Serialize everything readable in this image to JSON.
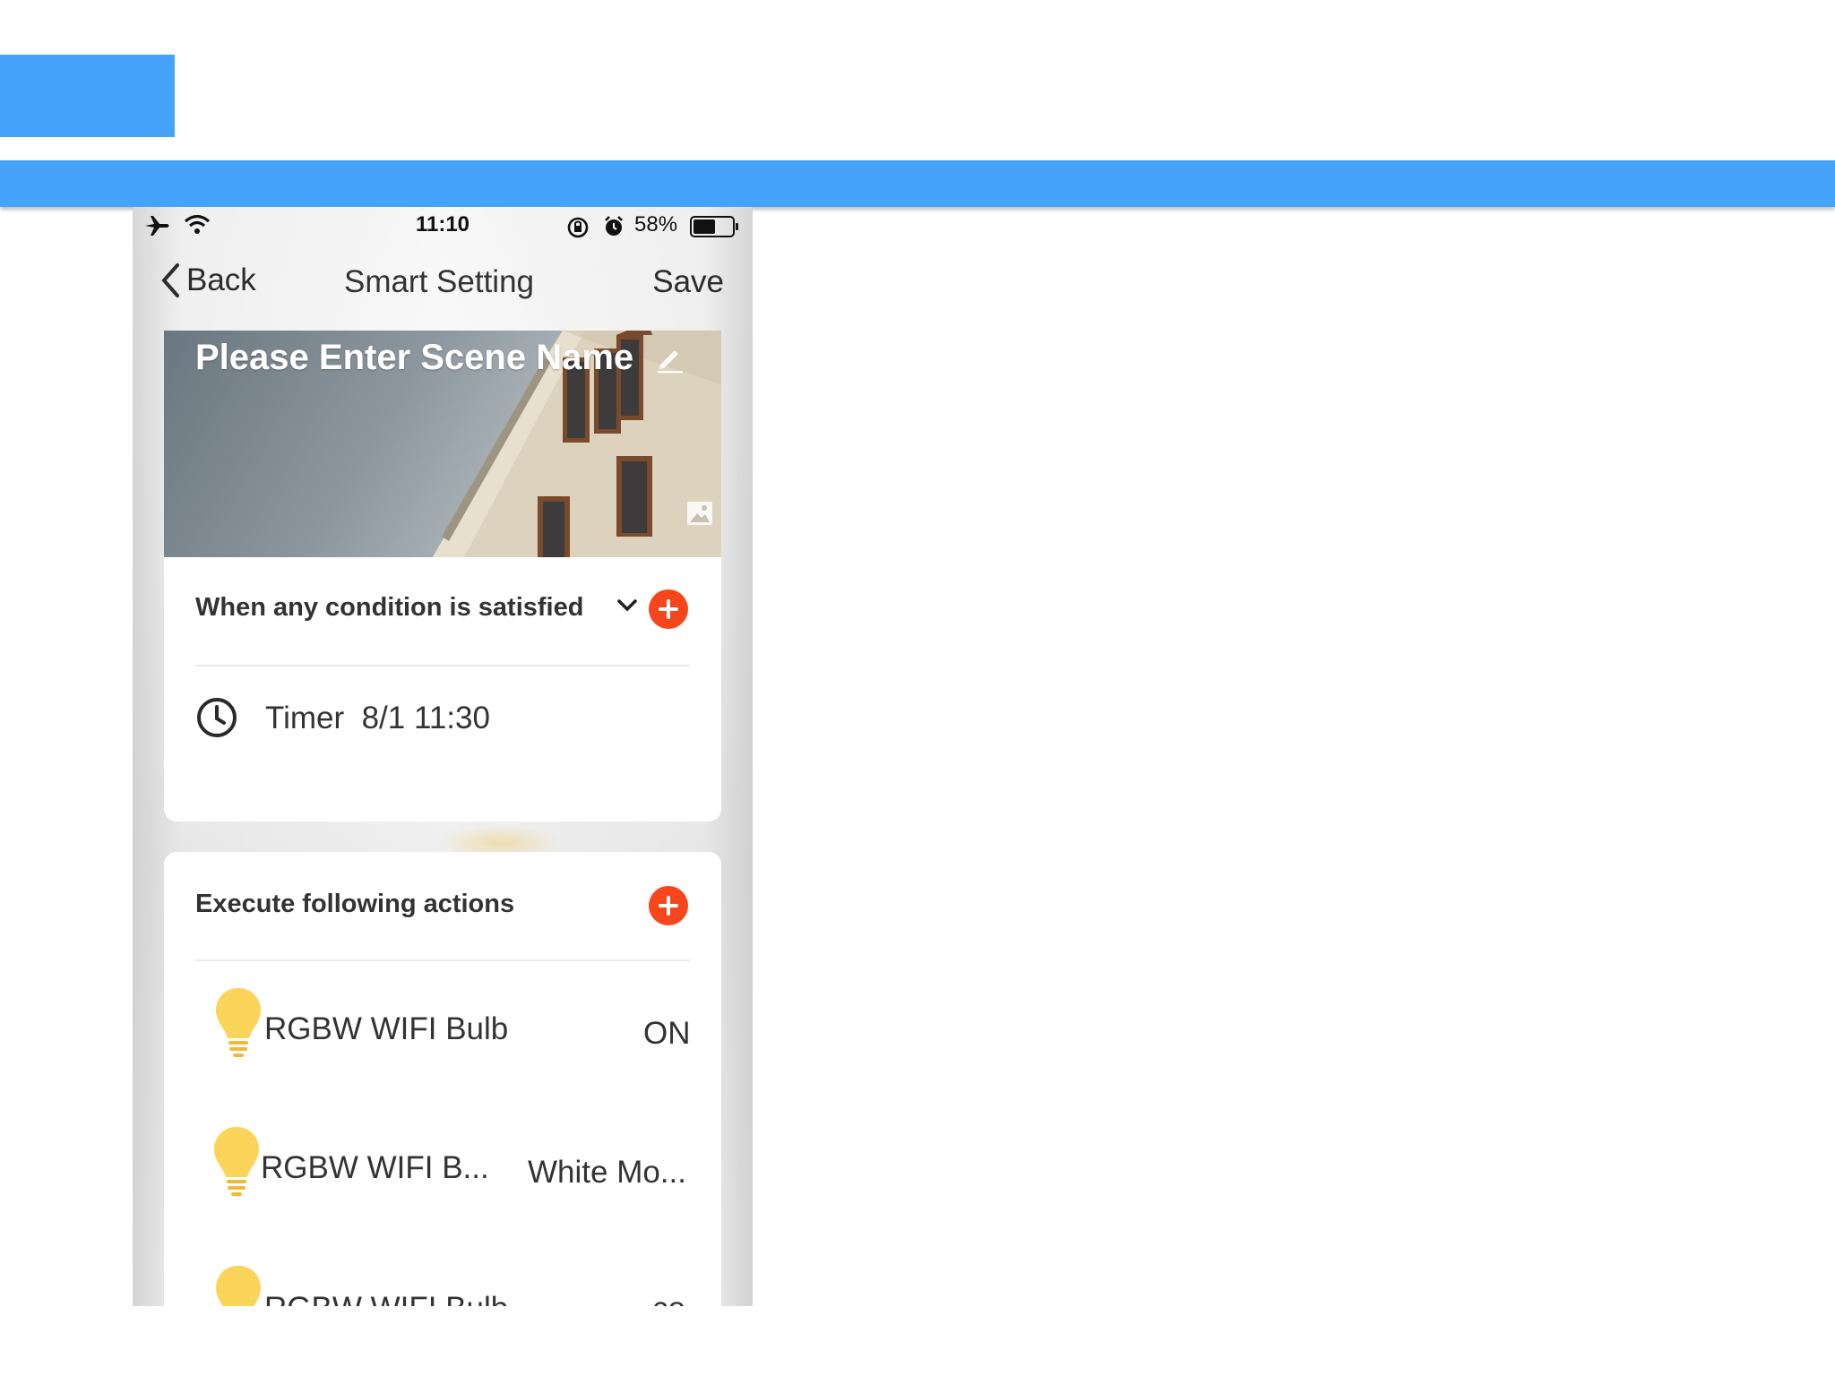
{
  "status_bar": {
    "time": "11:10",
    "battery_percent": "58%",
    "battery_level": 0.58,
    "icons": [
      "airplane-icon",
      "wifi-icon",
      "rotation-lock-icon",
      "alarm-icon",
      "battery-icon"
    ]
  },
  "nav": {
    "back_label": "Back",
    "title": "Smart Setting",
    "save_label": "Save"
  },
  "scene": {
    "name_placeholder": "Please Enter Scene Name",
    "edit_icon": "pencil-icon",
    "image_icon": "image-icon"
  },
  "condition": {
    "label": "When any condition is satisfied",
    "dropdown_icon": "chevron-down-icon",
    "add_icon": "plus-circle-icon",
    "items": [
      {
        "icon": "clock-icon",
        "label": "Timer  8/1 11:30"
      }
    ]
  },
  "actions": {
    "label": "Execute following actions",
    "add_icon": "plus-circle-icon",
    "items": [
      {
        "icon": "bulb-icon",
        "name": "RGBW WIFI Bulb",
        "value": "ON"
      },
      {
        "icon": "bulb-icon",
        "name": "RGBW WIFI B...",
        "value": "White Mo..."
      },
      {
        "icon": "bulb-icon",
        "name": "RGBW WIFI Bulb",
        "value": "co"
      }
    ]
  },
  "colors": {
    "header_blue": "#45a3fb",
    "add_button": "#f5471b",
    "bulb_yellow": "#fbd45a"
  }
}
